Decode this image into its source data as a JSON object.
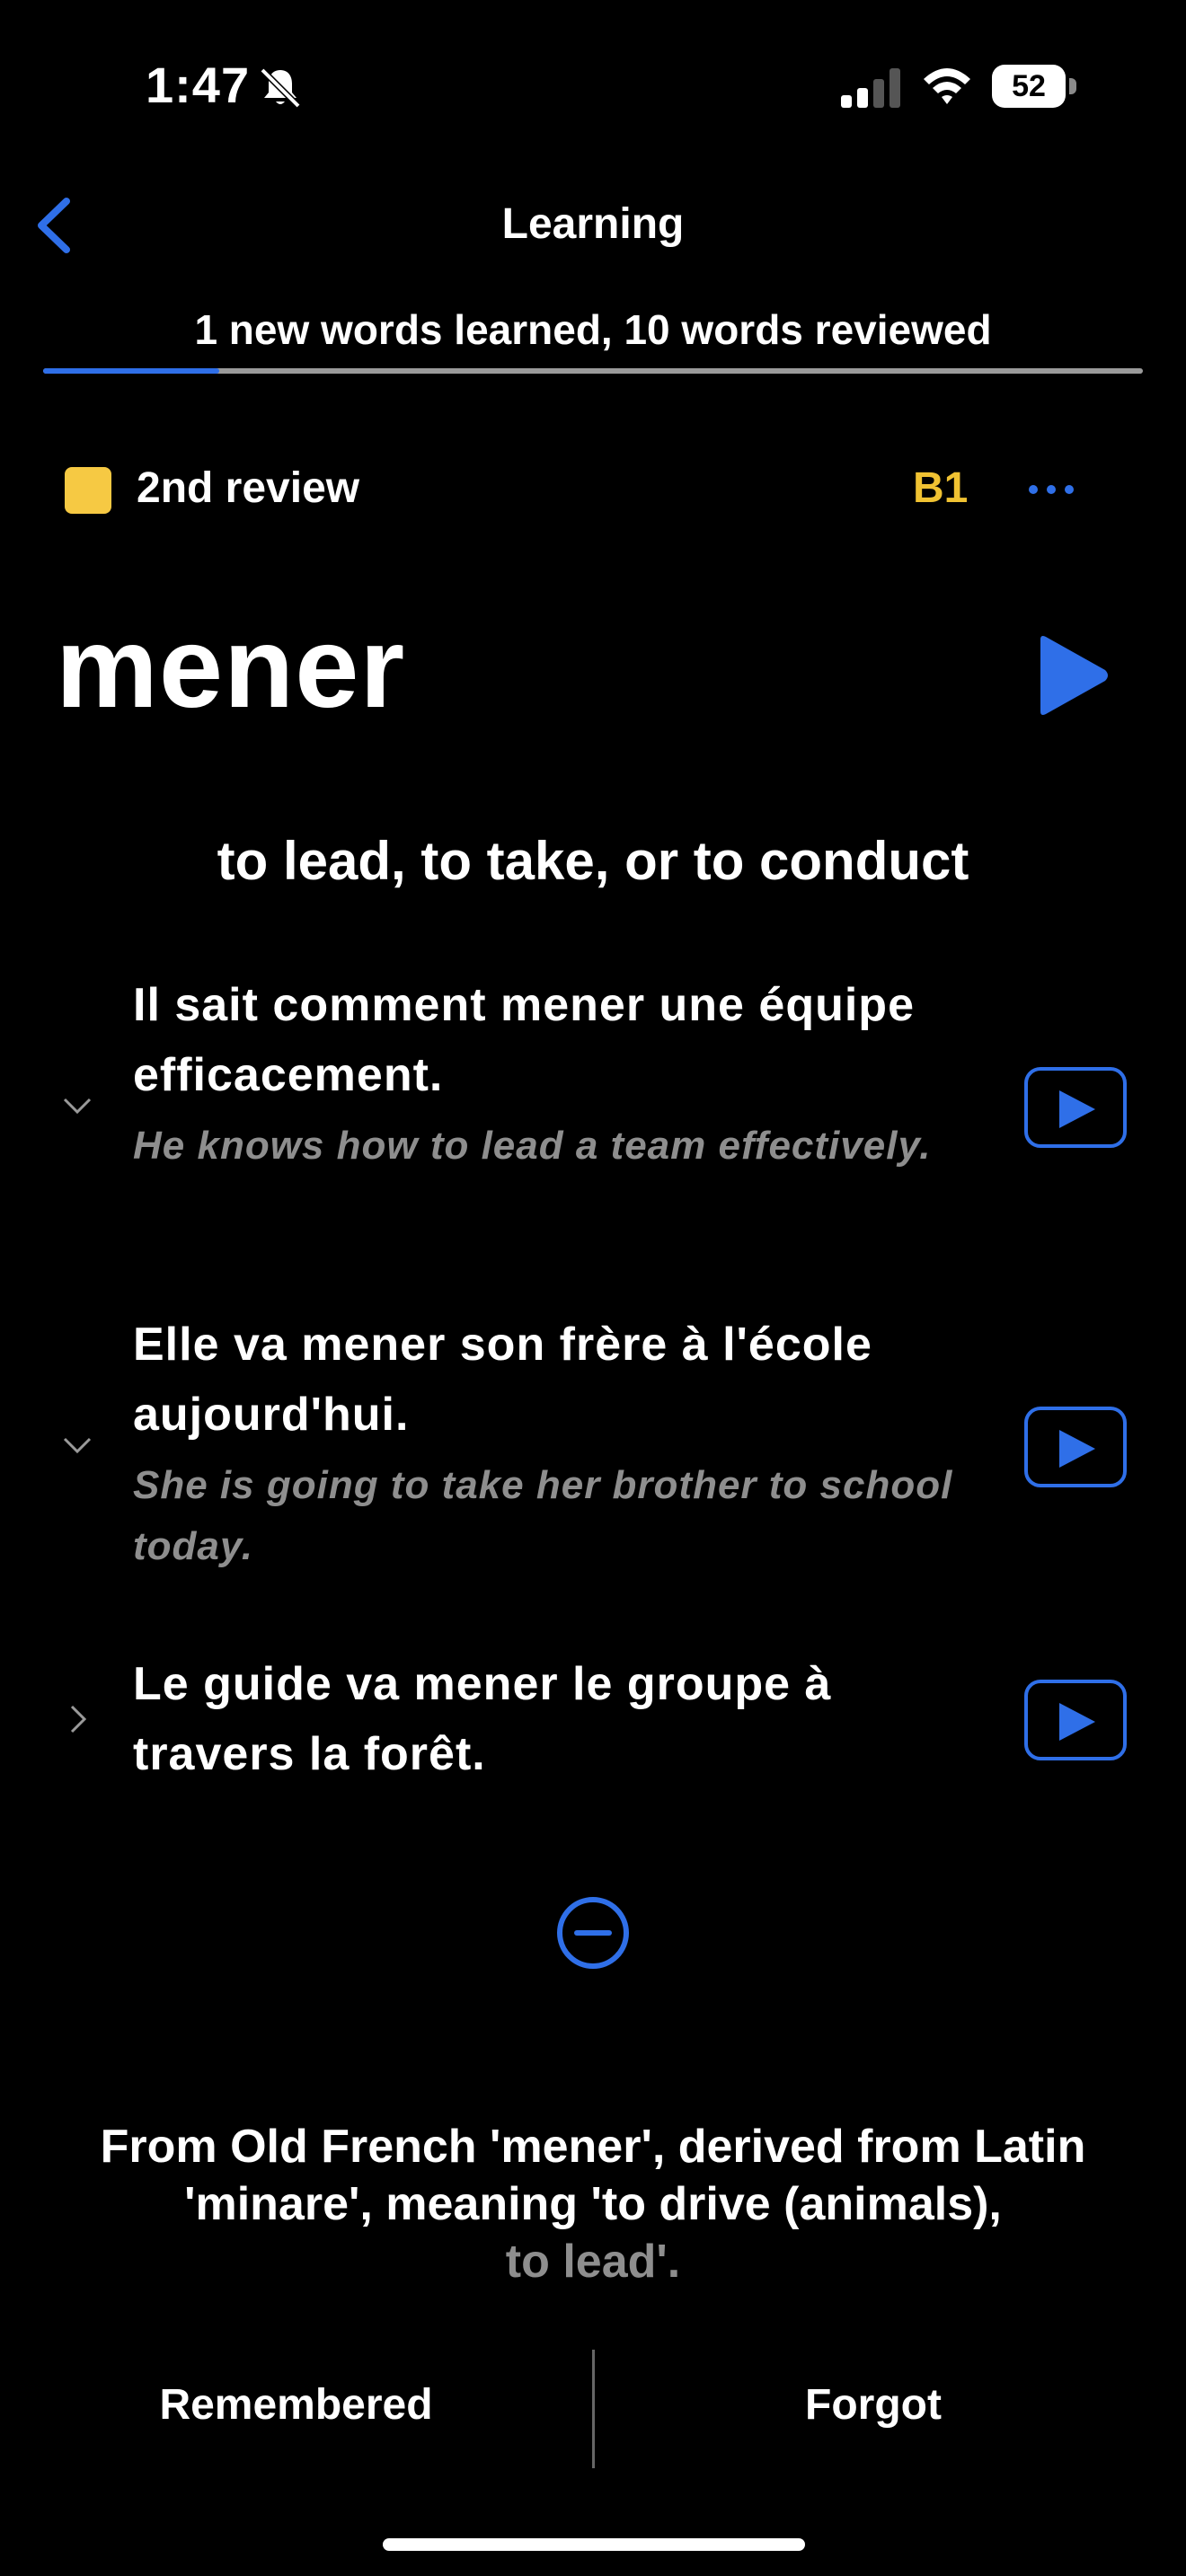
{
  "status_bar": {
    "time": "1:47",
    "battery": "52",
    "icons": [
      "bell-slash-icon",
      "cellular-signal-icon",
      "wifi-icon",
      "battery-icon"
    ]
  },
  "header": {
    "title": "Learning",
    "progress_text": "1 new words learned, 10 words reviewed",
    "progress_fraction": 0.16,
    "accent_color": "#2f6fe8"
  },
  "review": {
    "label": "2nd review",
    "level": "B1",
    "status_color": "#f6c943"
  },
  "word": {
    "text": "mener",
    "meaning": "to lead, to take, or to conduct"
  },
  "examples": [
    {
      "french": "Il sait comment mener une équipe efficacement.",
      "english": "He knows how to lead a team effectively.",
      "expanded": true
    },
    {
      "french": "Elle va mener son frère à l'école aujourd'hui.",
      "english": "She is going to take her brother to school today.",
      "expanded": true
    },
    {
      "french": "Le guide va mener le groupe à travers la forêt.",
      "english": "",
      "expanded": false
    }
  ],
  "etymology": {
    "text": "From Old French 'mener', derived from Latin 'minare', meaning 'to drive (animals),",
    "faded_tail": "to lead'."
  },
  "actions": {
    "remembered": "Remembered",
    "forgot": "Forgot"
  }
}
